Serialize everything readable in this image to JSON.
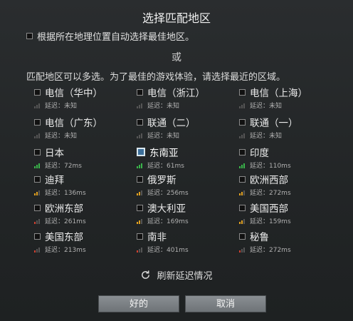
{
  "dialog": {
    "title": "选择匹配地区",
    "auto_label": "根据所在地理位置自动选择最佳地区。",
    "or_text": "或",
    "description": "匹配地区可以多选。为了最佳的游戏体验，请选择最近的区域。",
    "refresh_label": "刷新延迟情况",
    "ok_label": "好的",
    "cancel_label": "取消"
  },
  "colors": {
    "good": "#39b54a",
    "medium": "#e0a020",
    "bad": "#d04030",
    "unknown": "#555555"
  },
  "regions": [
    {
      "name": "电信（华中）",
      "latency": "延迟：未知",
      "quality": "unknown",
      "checked": false
    },
    {
      "name": "电信（浙江）",
      "latency": "延迟：未知",
      "quality": "unknown",
      "checked": false
    },
    {
      "name": "电信（上海）",
      "latency": "延迟：未知",
      "quality": "unknown",
      "checked": false
    },
    {
      "name": "电信（广东）",
      "latency": "延迟：未知",
      "quality": "unknown",
      "checked": false
    },
    {
      "name": "联通（二）",
      "latency": "延迟：未知",
      "quality": "unknown",
      "checked": false
    },
    {
      "name": "联通（一）",
      "latency": "延迟：未知",
      "quality": "unknown",
      "checked": false
    },
    {
      "name": "日本",
      "latency": "延迟：72ms",
      "quality": "good",
      "checked": false
    },
    {
      "name": "东南亚",
      "latency": "延迟：61ms",
      "quality": "good",
      "checked": true
    },
    {
      "name": "印度",
      "latency": "延迟：110ms",
      "quality": "good",
      "checked": false
    },
    {
      "name": "迪拜",
      "latency": "延迟：136ms",
      "quality": "medium",
      "checked": false
    },
    {
      "name": "俄罗斯",
      "latency": "延迟：256ms",
      "quality": "medium",
      "checked": false
    },
    {
      "name": "欧洲西部",
      "latency": "延迟：272ms",
      "quality": "medium",
      "checked": false
    },
    {
      "name": "欧洲东部",
      "latency": "延迟：261ms",
      "quality": "bad",
      "checked": false
    },
    {
      "name": "澳大利亚",
      "latency": "延迟：169ms",
      "quality": "medium",
      "checked": false
    },
    {
      "name": "美国西部",
      "latency": "延迟：159ms",
      "quality": "medium",
      "checked": false
    },
    {
      "name": "美国东部",
      "latency": "延迟：213ms",
      "quality": "bad",
      "checked": false
    },
    {
      "name": "南非",
      "latency": "延迟：401ms",
      "quality": "bad",
      "checked": false
    },
    {
      "name": "秘鲁",
      "latency": "延迟：272ms",
      "quality": "bad",
      "checked": false
    }
  ]
}
